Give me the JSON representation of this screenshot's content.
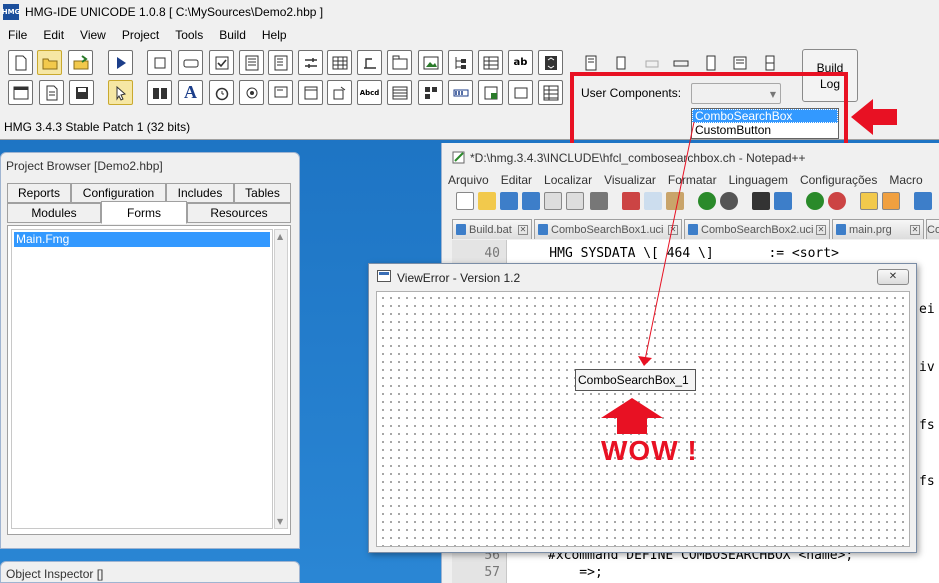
{
  "ide": {
    "app_icon_text": "HMG",
    "title": "HMG-IDE  UNICODE 1.0.8  [ C:\\MySources\\Demo2.hbp ]",
    "menu": [
      "File",
      "Edit",
      "View",
      "Project",
      "Tools",
      "Build",
      "Help"
    ],
    "status_text": "HMG 3.4.3 Stable Patch 1 (32 bits)",
    "build_log_label": "Build\nLog",
    "user_components": {
      "label": "User Components:",
      "options": [
        "ComboSearchBox",
        "CustomButton"
      ],
      "highlighted": "ComboSearchBox"
    },
    "colors": {
      "highlight": "#e81123",
      "selection": "#3399ff"
    }
  },
  "toolbar_icons": {
    "row1": [
      "new-file-icon",
      "open-folder-icon",
      "export-icon",
      "run-icon",
      "frame-icon",
      "button-icon",
      "checkbox-icon",
      "editbox-icon",
      "list-icon",
      "slider-icon",
      "grid-icon",
      "label-icon",
      "tab-icon",
      "image-icon",
      "tree-icon",
      "browse-icon",
      "textbox-icon",
      "spinner-icon"
    ],
    "row2": [
      "window-icon",
      "document-icon",
      "save-icon",
      "pointer-icon",
      "group-icon",
      "font-icon",
      "timer-icon",
      "radio-icon",
      "hyperlink-icon",
      "frame2-icon",
      "animation-icon",
      "richedit-icon",
      "datepicker-icon",
      "monthcal-icon",
      "progress-icon",
      "ipaddress-icon",
      "activex-icon",
      "grid2-icon"
    ]
  },
  "project_browser": {
    "title": "Project Browser [Demo2.hbp]",
    "tabs_row1": [
      "Reports",
      "Configuration",
      "Includes",
      "Tables"
    ],
    "tabs_row2": [
      "Modules",
      "Forms",
      "Resources"
    ],
    "active_tab": "Forms",
    "items": [
      "Main.Fmg"
    ]
  },
  "object_inspector": {
    "title": "Object Inspector []"
  },
  "notepad": {
    "title": "*D:\\hmg.3.4.3\\INCLUDE\\hfcl_combosearchbox.ch - Notepad++",
    "menu": [
      "Arquivo",
      "Editar",
      "Localizar",
      "Visualizar",
      "Formatar",
      "Linguagem",
      "Configurações",
      "Macro"
    ],
    "tabs": [
      "Build.bat",
      "ComboSearchBox1.uci",
      "ComboSearchBox2.uci",
      "main.prg",
      "Co"
    ],
    "lines": [
      {
        "num": "40",
        "text": "    HMG SYSDATA \\[ 464 \\]       := <sort>"
      },
      {
        "num": "56",
        "text": "#xcommand DEFINE COMBOSEARCHBOX <name>;"
      },
      {
        "num": "57",
        "text": "    =>;"
      }
    ],
    "fragments": [
      "ei",
      "iv",
      "fs",
      "fs"
    ]
  },
  "view_error": {
    "title": "ViewError - Version 1.2",
    "close_glyph": "✕",
    "control_label": "ComboSearchBox_1",
    "annotation": "WOW !"
  }
}
